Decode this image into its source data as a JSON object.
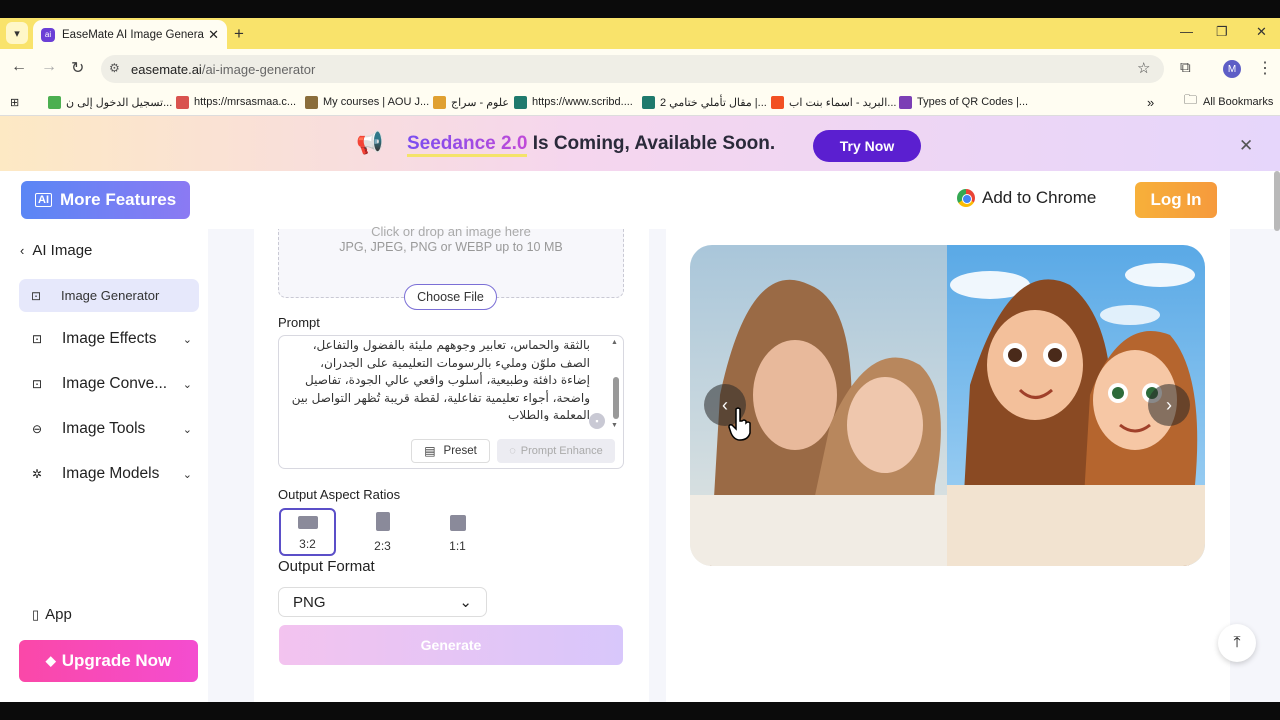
{
  "browser": {
    "tab_title": "EaseMate AI Image Generator: F",
    "tab_favicon": "ai",
    "tab_close": "✕",
    "new_tab": "+",
    "window_controls": {
      "minimize": "—",
      "restore": "❐",
      "close": "✕"
    },
    "url_domain": "easemate.ai",
    "url_path": "/ai-image-generator",
    "profile_initial": "M",
    "bookmarks": [
      {
        "label": "تسجيل الدخول إلى ن...",
        "color": "#4caf50"
      },
      {
        "label": "https://mrsasmaa.c...",
        "color": "#d9534f"
      },
      {
        "label": "My courses | AOU J...",
        "color": "#8a6d3b"
      },
      {
        "label": "علوم - سراج",
        "color": "#e0a030"
      },
      {
        "label": "https://www.scribd....",
        "color": "#1f7a6d"
      },
      {
        "label": "مقال تأملي ختامي 2 |...",
        "color": "#1f7a6d"
      },
      {
        "label": "البريد - اسماء بنت اب...",
        "color": "#f25022"
      },
      {
        "label": "Types of QR Codes |...",
        "color": "#7b3fb5"
      }
    ],
    "more_bookmarks": "»",
    "all_bookmarks": "All Bookmarks"
  },
  "banner": {
    "highlight": "Seedance 2.0",
    "text": " Is Coming, Available Soon.",
    "cta": "Try Now",
    "close": "✕"
  },
  "header": {
    "more_features": "More Features",
    "more_features_icon": "AI",
    "add_to_chrome": "Add to Chrome",
    "login": "Log In"
  },
  "sidebar": {
    "back_label": "AI Image",
    "active_item": "Image Generator",
    "items": [
      {
        "label": "Image Effects"
      },
      {
        "label": "Image Conve..."
      },
      {
        "label": "Image Tools"
      },
      {
        "label": "Image Models"
      }
    ],
    "app": "App",
    "upgrade": "Upgrade Now"
  },
  "upload": {
    "line1": "Click or drop an image here",
    "line2": "JPG, JPEG, PNG or WEBP up to 10 MB",
    "choose_file": "Choose File"
  },
  "prompt": {
    "label": "Prompt",
    "text": "بالثقة والحماس، تعابير وجوههم مليئة بالفضول والتفاعل، الصف ملوّن ومليء بالرسومات التعليمية على الجدران، إضاءة دافئة وطبيعية، أسلوب واقعي عالي الجودة، تفاصيل واضحة، أجواء تعليمية تفاعلية، لقطة قريبة تُظهر التواصل بين المعلمة والطلاب",
    "preset": "Preset",
    "enhance": "Prompt Enhance"
  },
  "aspect": {
    "label": "Output Aspect Ratios",
    "options": [
      {
        "label": "3:2",
        "selected": true
      },
      {
        "label": "2:3",
        "selected": false
      },
      {
        "label": "1:1",
        "selected": false
      }
    ]
  },
  "format": {
    "label": "Output Format",
    "value": "PNG"
  },
  "generate": "Generate",
  "preview": {
    "prev": "‹",
    "next": "›",
    "to_top": "⤒"
  },
  "colors": {
    "accent": "#5b1fd0",
    "login": "#f7a83b",
    "upgrade": "#f748b8",
    "sidebar_active": "#e6e8fb"
  }
}
